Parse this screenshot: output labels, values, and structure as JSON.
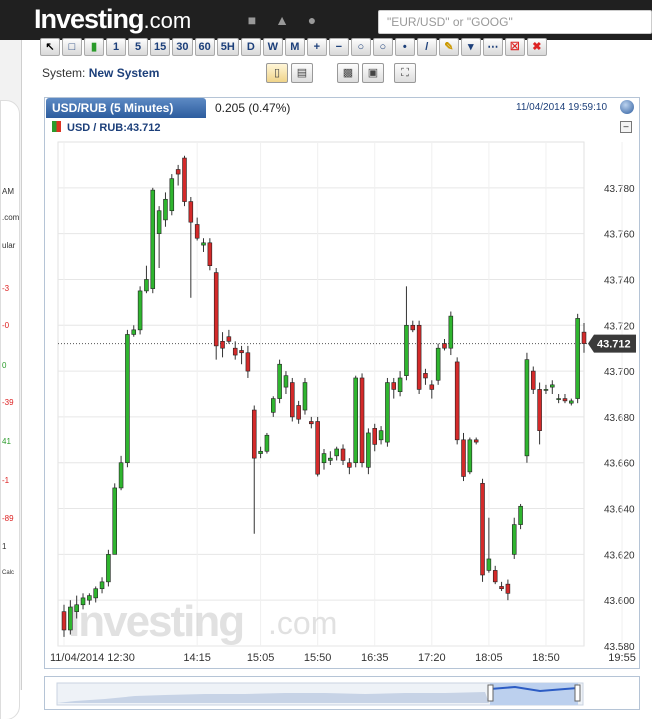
{
  "header": {
    "logo_main": "Investing",
    "logo_suffix": ".com",
    "search_placeholder": "\"EUR/USD\" or \"GOOG\"",
    "icons": [
      "briefcase-icon",
      "bell-icon",
      "globe-icon"
    ]
  },
  "side_fragment": {
    "texts": [
      "AM",
      ".com",
      "ular",
      "-3",
      "-0",
      "0",
      "-39",
      "41",
      "-1",
      "-89",
      "1",
      "Calc"
    ]
  },
  "toolbar": {
    "buttons": [
      "1",
      "5",
      "15",
      "30",
      "60",
      "5H",
      "D",
      "W",
      "M"
    ]
  },
  "system": {
    "label": "System:",
    "name": "New System"
  },
  "chart_header": {
    "tab_title": "USD/RUB (5 Minutes)",
    "change": "0.205 (0.47%)",
    "datetime": "11/04/2014 19:59:10",
    "legend": "USD / RUB:43.712"
  },
  "watermark": {
    "main": "Investing",
    "suffix": ".com"
  },
  "colors": {
    "up": "#2fb52f",
    "down": "#d42a2a",
    "grid": "#e6e6e6",
    "header_bg": "#202020",
    "tab_blue": "#2c5c9e"
  },
  "chart_data": {
    "type": "candlestick",
    "title": "USD/RUB (5 Minutes)",
    "current_value": 43.712,
    "current_value_label": "43.712",
    "ylim": [
      43.58,
      43.8
    ],
    "y_ticks": [
      "43.780",
      "43.760",
      "43.740",
      "43.720",
      "43.700",
      "43.680",
      "43.660",
      "43.640",
      "43.620",
      "43.600",
      "43.580"
    ],
    "y_tick_values": [
      43.78,
      43.76,
      43.74,
      43.72,
      43.7,
      43.68,
      43.66,
      43.64,
      43.62,
      43.6,
      43.58
    ],
    "x_tick_labels": [
      "11/04/2014 12:30",
      "14:15",
      "15:05",
      "15:50",
      "16:35",
      "17:20",
      "18:05",
      "18:50",
      "19:55"
    ],
    "x_tick_index": [
      0,
      21,
      31,
      40,
      49,
      58,
      67,
      76,
      88
    ],
    "grid": true,
    "candles": [
      {
        "o": 43.595,
        "h": 43.598,
        "l": 43.584,
        "c": 43.587
      },
      {
        "o": 43.587,
        "h": 43.6,
        "l": 43.585,
        "c": 43.597
      },
      {
        "o": 43.595,
        "h": 43.602,
        "l": 43.592,
        "c": 43.598
      },
      {
        "o": 43.598,
        "h": 43.603,
        "l": 43.596,
        "c": 43.601
      },
      {
        "o": 43.6,
        "h": 43.603,
        "l": 43.598,
        "c": 43.602
      },
      {
        "o": 43.601,
        "h": 43.606,
        "l": 43.599,
        "c": 43.605
      },
      {
        "o": 43.605,
        "h": 43.61,
        "l": 43.603,
        "c": 43.608
      },
      {
        "o": 43.608,
        "h": 43.622,
        "l": 43.606,
        "c": 43.62
      },
      {
        "o": 43.62,
        "h": 43.651,
        "l": 43.627,
        "c": 43.649
      },
      {
        "o": 43.649,
        "h": 43.663,
        "l": 43.648,
        "c": 43.66
      },
      {
        "o": 43.66,
        "h": 43.718,
        "l": 43.658,
        "c": 43.716
      },
      {
        "o": 43.716,
        "h": 43.72,
        "l": 43.715,
        "c": 43.718
      },
      {
        "o": 43.718,
        "h": 43.737,
        "l": 43.716,
        "c": 43.735
      },
      {
        "o": 43.735,
        "h": 43.746,
        "l": 43.734,
        "c": 43.74
      },
      {
        "o": 43.736,
        "h": 43.78,
        "l": 43.734,
        "c": 43.779
      },
      {
        "o": 43.76,
        "h": 43.772,
        "l": 43.745,
        "c": 43.77
      },
      {
        "o": 43.766,
        "h": 43.778,
        "l": 43.763,
        "c": 43.775
      },
      {
        "o": 43.77,
        "h": 43.786,
        "l": 43.768,
        "c": 43.784
      },
      {
        "o": 43.788,
        "h": 43.79,
        "l": 43.781,
        "c": 43.786
      },
      {
        "o": 43.793,
        "h": 43.794,
        "l": 43.772,
        "c": 43.774
      },
      {
        "o": 43.774,
        "h": 43.776,
        "l": 43.732,
        "c": 43.765
      },
      {
        "o": 43.764,
        "h": 43.767,
        "l": 43.757,
        "c": 43.758
      },
      {
        "o": 43.755,
        "h": 43.758,
        "l": 43.752,
        "c": 43.756
      },
      {
        "o": 43.756,
        "h": 43.758,
        "l": 43.744,
        "c": 43.746
      },
      {
        "o": 43.743,
        "h": 43.745,
        "l": 43.705,
        "c": 43.711
      },
      {
        "o": 43.713,
        "h": 43.717,
        "l": 43.706,
        "c": 43.71
      },
      {
        "o": 43.715,
        "h": 43.718,
        "l": 43.712,
        "c": 43.713
      },
      {
        "o": 43.71,
        "h": 43.713,
        "l": 43.705,
        "c": 43.707
      },
      {
        "o": 43.709,
        "h": 43.711,
        "l": 43.703,
        "c": 43.708
      },
      {
        "o": 43.708,
        "h": 43.711,
        "l": 43.697,
        "c": 43.7
      },
      {
        "o": 43.683,
        "h": 43.685,
        "l": 43.629,
        "c": 43.662
      },
      {
        "o": 43.664,
        "h": 43.667,
        "l": 43.662,
        "c": 43.665
      },
      {
        "o": 43.665,
        "h": 43.673,
        "l": 43.664,
        "c": 43.672
      },
      {
        "o": 43.682,
        "h": 43.689,
        "l": 43.68,
        "c": 43.688
      },
      {
        "o": 43.688,
        "h": 43.705,
        "l": 43.686,
        "c": 43.703
      },
      {
        "o": 43.693,
        "h": 43.7,
        "l": 43.69,
        "c": 43.698
      },
      {
        "o": 43.695,
        "h": 43.697,
        "l": 43.678,
        "c": 43.68
      },
      {
        "o": 43.685,
        "h": 43.687,
        "l": 43.677,
        "c": 43.679
      },
      {
        "o": 43.683,
        "h": 43.697,
        "l": 43.681,
        "c": 43.695
      },
      {
        "o": 43.678,
        "h": 43.68,
        "l": 43.675,
        "c": 43.677
      },
      {
        "o": 43.678,
        "h": 43.68,
        "l": 43.654,
        "c": 43.655
      },
      {
        "o": 43.66,
        "h": 43.666,
        "l": 43.657,
        "c": 43.664
      },
      {
        "o": 43.661,
        "h": 43.665,
        "l": 43.659,
        "c": 43.662
      },
      {
        "o": 43.663,
        "h": 43.667,
        "l": 43.661,
        "c": 43.666
      },
      {
        "o": 43.666,
        "h": 43.668,
        "l": 43.659,
        "c": 43.661
      },
      {
        "o": 43.66,
        "h": 43.662,
        "l": 43.655,
        "c": 43.658
      },
      {
        "o": 43.66,
        "h": 43.698,
        "l": 43.658,
        "c": 43.697
      },
      {
        "o": 43.697,
        "h": 43.699,
        "l": 43.658,
        "c": 43.66
      },
      {
        "o": 43.658,
        "h": 43.675,
        "l": 43.655,
        "c": 43.673
      },
      {
        "o": 43.675,
        "h": 43.677,
        "l": 43.665,
        "c": 43.668
      },
      {
        "o": 43.67,
        "h": 43.676,
        "l": 43.668,
        "c": 43.674
      },
      {
        "o": 43.669,
        "h": 43.697,
        "l": 43.667,
        "c": 43.695
      },
      {
        "o": 43.695,
        "h": 43.697,
        "l": 43.688,
        "c": 43.692
      },
      {
        "o": 43.691,
        "h": 43.7,
        "l": 43.689,
        "c": 43.697
      },
      {
        "o": 43.698,
        "h": 43.737,
        "l": 43.696,
        "c": 43.72
      },
      {
        "o": 43.72,
        "h": 43.722,
        "l": 43.717,
        "c": 43.718
      },
      {
        "o": 43.72,
        "h": 43.722,
        "l": 43.69,
        "c": 43.692
      },
      {
        "o": 43.699,
        "h": 43.701,
        "l": 43.694,
        "c": 43.697
      },
      {
        "o": 43.694,
        "h": 43.696,
        "l": 43.688,
        "c": 43.692
      },
      {
        "o": 43.696,
        "h": 43.712,
        "l": 43.694,
        "c": 43.71
      },
      {
        "o": 43.712,
        "h": 43.714,
        "l": 43.709,
        "c": 43.71
      },
      {
        "o": 43.71,
        "h": 43.726,
        "l": 43.707,
        "c": 43.724
      },
      {
        "o": 43.704,
        "h": 43.706,
        "l": 43.668,
        "c": 43.67
      },
      {
        "o": 43.67,
        "h": 43.673,
        "l": 43.652,
        "c": 43.654
      },
      {
        "o": 43.656,
        "h": 43.671,
        "l": 43.655,
        "c": 43.67
      },
      {
        "o": 43.67,
        "h": 43.671,
        "l": 43.668,
        "c": 43.669
      },
      {
        "o": 43.651,
        "h": 43.653,
        "l": 43.608,
        "c": 43.611
      },
      {
        "o": 43.613,
        "h": 43.636,
        "l": 43.612,
        "c": 43.618
      },
      {
        "o": 43.613,
        "h": 43.615,
        "l": 43.607,
        "c": 43.608
      },
      {
        "o": 43.606,
        "h": 43.608,
        "l": 43.604,
        "c": 43.605
      },
      {
        "o": 43.607,
        "h": 43.609,
        "l": 43.6,
        "c": 43.603
      },
      {
        "o": 43.62,
        "h": 43.636,
        "l": 43.618,
        "c": 43.633
      },
      {
        "o": 43.633,
        "h": 43.642,
        "l": 43.631,
        "c": 43.641
      },
      {
        "o": 43.663,
        "h": 43.708,
        "l": 43.66,
        "c": 43.705
      },
      {
        "o": 43.7,
        "h": 43.702,
        "l": 43.69,
        "c": 43.692
      },
      {
        "o": 43.692,
        "h": 43.695,
        "l": 43.668,
        "c": 43.674
      },
      {
        "o": 43.692,
        "h": 43.694,
        "l": 43.69,
        "c": 43.692
      },
      {
        "o": 43.693,
        "h": 43.696,
        "l": 43.69,
        "c": 43.694
      },
      {
        "o": 43.688,
        "h": 43.69,
        "l": 43.686,
        "c": 43.688
      },
      {
        "o": 43.688,
        "h": 43.69,
        "l": 43.686,
        "c": 43.687
      },
      {
        "o": 43.686,
        "h": 43.688,
        "l": 43.685,
        "c": 43.687
      },
      {
        "o": 43.688,
        "h": 43.725,
        "l": 43.686,
        "c": 43.723
      },
      {
        "o": 43.717,
        "h": 43.721,
        "l": 43.708,
        "c": 43.712
      }
    ]
  }
}
